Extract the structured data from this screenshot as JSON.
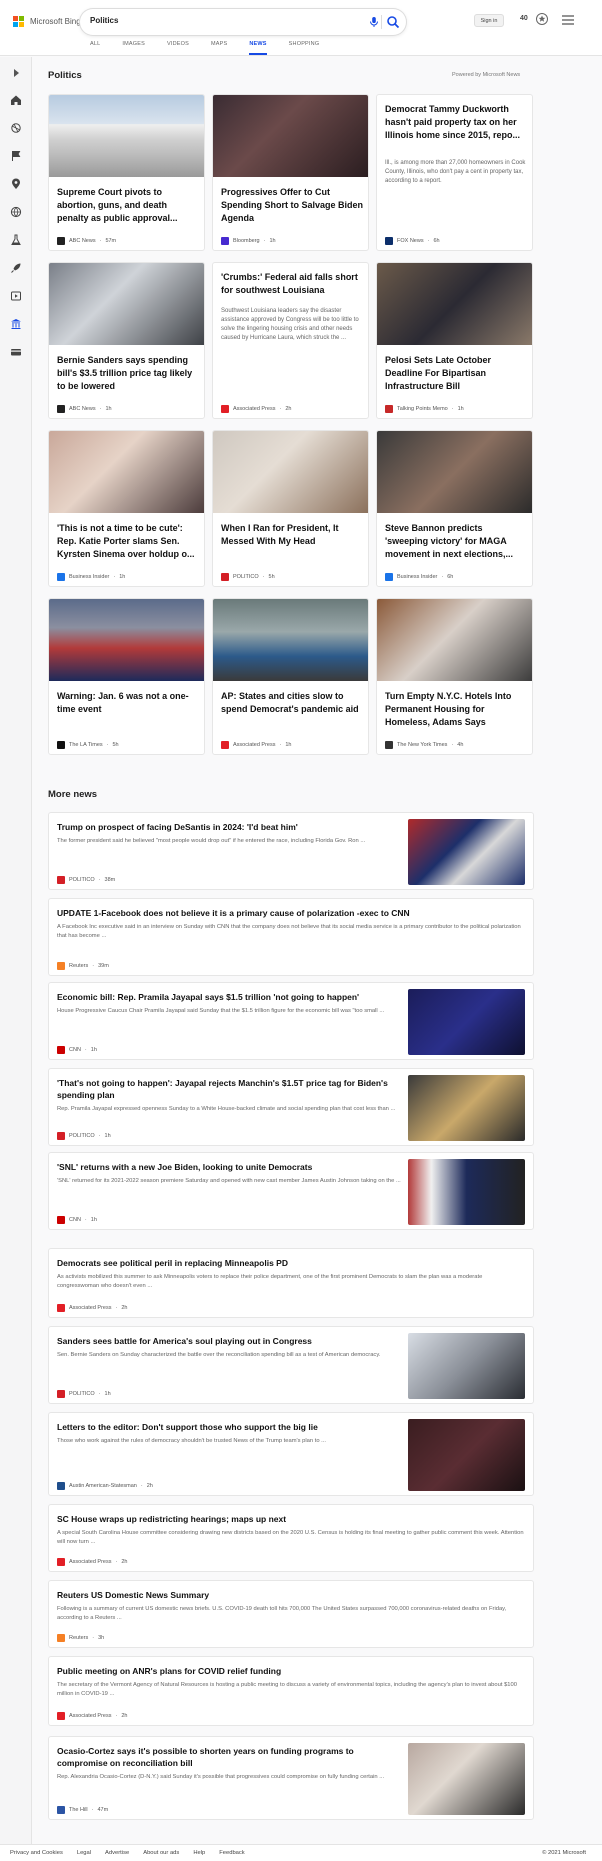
{
  "header": {
    "brand": "Microsoft Bing",
    "query": "Politics",
    "sign_in": "Sign in",
    "points": "40",
    "icons": [
      "microphone-icon",
      "search-icon",
      "rewards-icon",
      "hamburger-menu-icon"
    ]
  },
  "tabs": [
    "ALL",
    "IMAGES",
    "VIDEOS",
    "MAPS",
    "NEWS",
    "SHOPPING"
  ],
  "active_tab": "NEWS",
  "rail_icons": [
    "expand-icon",
    "home-icon",
    "sports-icon",
    "flag-icon",
    "location-icon",
    "globe-icon",
    "science-icon",
    "rocket-icon",
    "entertainment-icon",
    "politics-icon",
    "money-icon"
  ],
  "section": {
    "title": "Politics",
    "powered_by": "Powered by Microsoft News"
  },
  "top_cards": [
    {
      "title": "Supreme Court pivots to abortion, guns, and death penalty as public approval...",
      "source": "ABC News",
      "age": "57m",
      "src_color": "#222222"
    },
    {
      "title": "Progressives Offer to Cut Spending Short to Salvage Biden Agenda",
      "source": "Bloomberg",
      "age": "1h",
      "src_color": "#472ad0"
    },
    {
      "title": "Democrat Tammy Duckworth hasn't paid property tax on her Illinois home since 2015, repo...",
      "snippet": "Ill., is among more than 27,000 homeowners in Cook County, Illinois, who don't pay a cent in property tax, according to a report.",
      "source": "FOX News",
      "age": "6h",
      "src_color": "#0c2f6b"
    },
    {
      "title": "Bernie Sanders says spending bill's $3.5 trillion price tag likely to be lowered",
      "source": "ABC News",
      "age": "1h",
      "src_color": "#222222"
    },
    {
      "title": "'Crumbs:' Federal aid falls short for southwest Louisiana",
      "snippet": "Southwest Louisiana leaders say the disaster assistance approved by Congress will be too little to solve the lingering housing crisis and other needs caused by Hurricane Laura, which struck the ...",
      "source": "Associated Press",
      "age": "2h",
      "src_color": "#e21f26"
    },
    {
      "title": "Pelosi Sets Late October Deadline For Bipartisan Infrastructure Bill",
      "source": "Talking Points Memo",
      "age": "1h",
      "src_color": "#c62828"
    },
    {
      "title": "'This is not a time to be cute': Rep. Katie Porter slams Sen. Kyrsten Sinema over holdup o...",
      "source": "Business Insider",
      "age": "1h",
      "src_color": "#1a73e8"
    },
    {
      "title": "When I Ran for President, It Messed With My Head",
      "source": "POLITICO",
      "age": "5h",
      "src_color": "#d41f26"
    },
    {
      "title": "Steve Bannon predicts 'sweeping victory' for MAGA movement in next elections,...",
      "source": "Business Insider",
      "age": "6h",
      "src_color": "#1a73e8"
    },
    {
      "title": "Warning: Jan. 6 was not a one-time event",
      "source": "The LA Times",
      "age": "5h",
      "src_color": "#111111"
    },
    {
      "title": "AP: States and cities slow to spend Democrat's pandemic aid",
      "source": "Associated Press",
      "age": "1h",
      "src_color": "#e21f26"
    },
    {
      "title": "Turn Empty N.Y.C. Hotels Into Permanent Housing for Homeless, Adams Says",
      "source": "The New York Times",
      "age": "4h",
      "src_color": "#333333"
    }
  ],
  "more_news": {
    "title": "More news",
    "items": [
      {
        "title": "Trump on prospect of facing DeSantis in 2024: 'I'd beat him'",
        "snippet": "The former president said he believed \"most people would drop out\" if he entered the race, including Florida Gov. Ron ...",
        "source": "POLITICO",
        "age": "38m",
        "src_color": "#d41f26"
      },
      {
        "title": "UPDATE 1-Facebook does not believe it is a primary cause of polarization -exec to CNN",
        "snippet": "A Facebook Inc executive said in an interview on Sunday with CNN that the company does not believe that its social media service is a primary contributor to the political polarization that has become ...",
        "source": "Reuters",
        "age": "39m",
        "src_color": "#f58025"
      },
      {
        "title": "Economic bill: Rep. Pramila Jayapal says $1.5 trillion 'not going to happen'",
        "snippet": "House Progressive Caucus Chair Pramila Jayapal said Sunday that the $1.5 trillion figure for the economic bill was \"too small ...",
        "source": "CNN",
        "age": "1h",
        "src_color": "#cc0000"
      },
      {
        "title": "'That's not going to happen': Jayapal rejects Manchin's $1.5T price tag for Biden's spending plan",
        "snippet": "Rep. Pramila Jayapal expressed openness Sunday to a White House-backed climate and social spending plan that cost less than ...",
        "source": "POLITICO",
        "age": "1h",
        "src_color": "#d41f26"
      },
      {
        "title": "'SNL' returns with a new Joe Biden, looking to unite Democrats",
        "snippet": "'SNL' returned for its 2021-2022 season premiere Saturday and opened with new cast member James Austin Johnson taking on the ...",
        "source": "CNN",
        "age": "1h",
        "src_color": "#cc0000"
      },
      {
        "title": "Democrats see political peril in replacing Minneapolis PD",
        "snippet": "As activists mobilized this summer to ask Minneapolis voters to replace their police department, one of the first prominent Democrats to slam the plan was a moderate congresswoman who doesn't even ...",
        "source": "Associated Press",
        "age": "2h",
        "src_color": "#e21f26"
      },
      {
        "title": "Sanders sees battle for America's soul playing out in Congress",
        "snippet": "Sen. Bernie Sanders on Sunday characterized the battle over the reconciliation spending bill as a test of American democracy.",
        "source": "POLITICO",
        "age": "1h",
        "src_color": "#d41f26"
      },
      {
        "title": "Letters to the editor: Don't support those who support the big lie",
        "snippet": "Those who work against the rules of democracy shouldn't be trusted News of the Trump team's plan to ...",
        "source": "Austin American-Statesman",
        "age": "2h",
        "src_color": "#1f4e8c"
      },
      {
        "title": "SC House wraps up redistricting hearings; maps up next",
        "snippet": "A special South Carolina House committee considering drawing new districts based on the 2020 U.S. Census is holding its final meeting to gather public comment this week. Attention will now turn ...",
        "source": "Associated Press",
        "age": "2h",
        "src_color": "#e21f26"
      },
      {
        "title": "Reuters US Domestic News Summary",
        "snippet": "Following is a summary of current US domestic news briefs. U.S. COVID-19 death toll hits 700,000 The United States surpassed 700,000 coronavirus-related deaths on Friday, according to a Reuters ...",
        "source": "Reuters",
        "age": "3h",
        "src_color": "#f58025"
      },
      {
        "title": "Public meeting on ANR's plans for COVID relief funding",
        "snippet": "The secretary of the Vermont Agency of Natural Resources is hosting a public meeting to discuss a variety of environmental topics, including the agency's plan to invest about $100 million in COVID-19 ...",
        "source": "Associated Press",
        "age": "2h",
        "src_color": "#e21f26"
      },
      {
        "title": "Ocasio-Cortez says it's possible to shorten years on funding programs to compromise on reconciliation bill",
        "snippet": "Rep. Alexandria Ocasio-Cortez (D-N.Y.) said Sunday it's possible that progressives could compromise on fully funding certain ...",
        "source": "The Hill",
        "age": "47m",
        "src_color": "#2b54a4"
      }
    ]
  },
  "footer": {
    "links": [
      "Privacy and Cookies",
      "Legal",
      "Advertise",
      "About our ads",
      "Help",
      "Feedback"
    ],
    "copyright": "© 2021 Microsoft"
  }
}
